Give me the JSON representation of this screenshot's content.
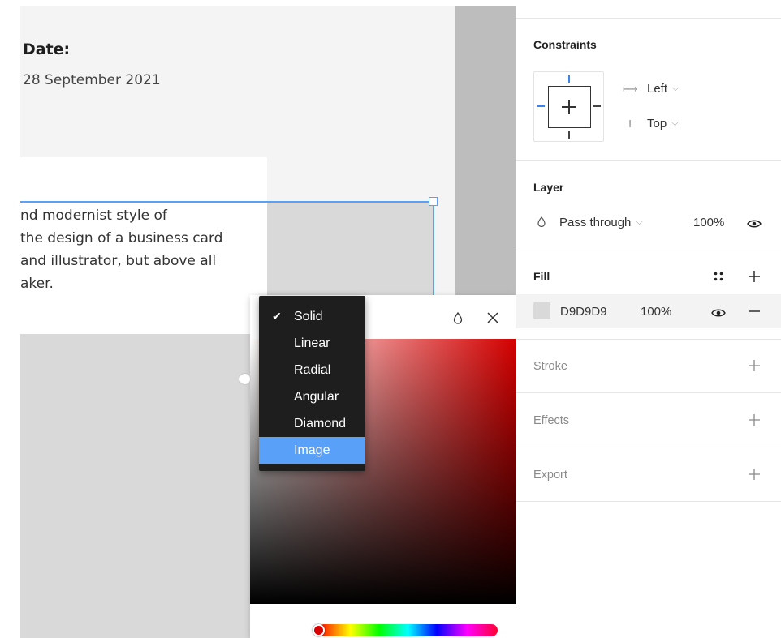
{
  "canvas": {
    "date_label": "Date:",
    "date_value": "28 September 2021",
    "paragraph_lines": [
      "nd modernist style of",
      "the design of a business card",
      " and illustrator, but above all",
      "aker."
    ]
  },
  "fill_type_menu": {
    "items": [
      "Solid",
      "Linear",
      "Radial",
      "Angular",
      "Diamond",
      "Image"
    ],
    "checked": "Solid",
    "highlighted": "Image"
  },
  "color_picker": {
    "base_color": "#D40000",
    "hue_color": "#D80000"
  },
  "panel": {
    "constraints": {
      "title": "Constraints",
      "horizontal": "Left",
      "vertical": "Top"
    },
    "layer": {
      "title": "Layer",
      "blend_mode": "Pass through",
      "opacity": "100%"
    },
    "fill": {
      "title": "Fill",
      "hex": "D9D9D9",
      "opacity": "100%",
      "swatch_color": "#D9D9D9"
    },
    "stroke": {
      "title": "Stroke"
    },
    "effects": {
      "title": "Effects"
    },
    "export": {
      "title": "Export"
    }
  },
  "colors": {
    "selection_blue": "#5AA0F4",
    "menu_bg": "#1E1E1E",
    "menu_highlight": "#58A0F8"
  }
}
